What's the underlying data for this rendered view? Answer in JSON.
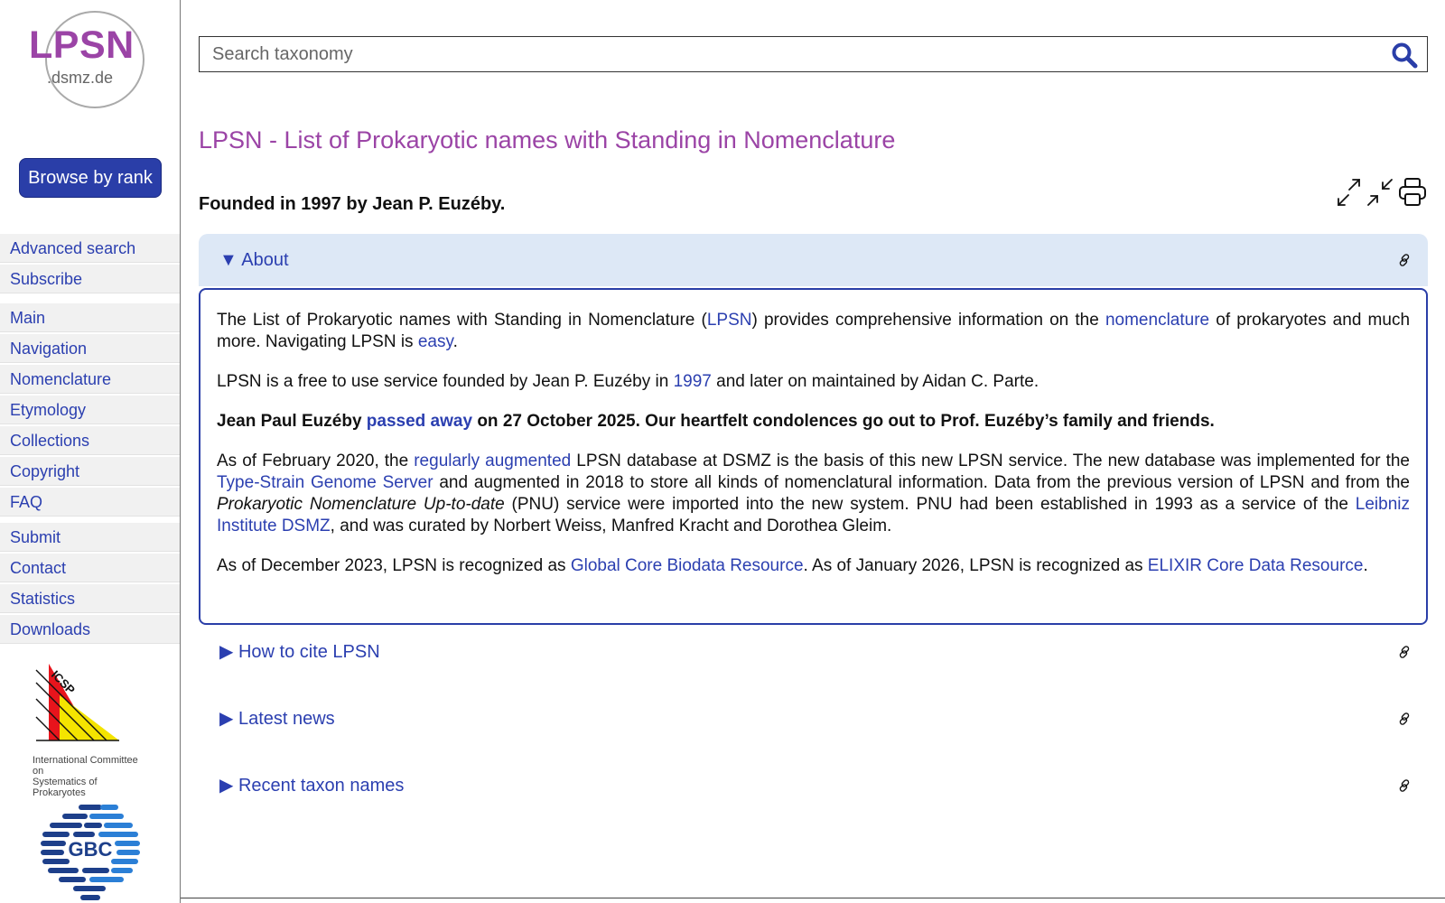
{
  "sidebar": {
    "logo_main": "LPSN",
    "logo_sub": ".dsmz.de",
    "browse_label": "Browse by rank",
    "groups": [
      [
        "Advanced search",
        "Subscribe"
      ],
      [
        "Main",
        "Navigation",
        "Nomenclature",
        "Etymology",
        "Collections",
        "Copyright",
        "FAQ"
      ],
      [
        "Submit",
        "Contact",
        "Statistics",
        "Downloads"
      ]
    ],
    "icsp_label": "ICSP",
    "icsp_caption_1": "International Committee on",
    "icsp_caption_2": "Systematics of Prokaryotes",
    "gbc_label": "GBC"
  },
  "search": {
    "placeholder": "Search taxonomy"
  },
  "header": {
    "title": "LPSN - List of Prokaryotic names with Standing in Nomenclature",
    "founded": "Founded in 1997 by Jean P. Euzéby."
  },
  "sections": {
    "about": {
      "toggle": "▼",
      "label": "About",
      "p1_a": "The List of Prokaryotic names with Standing in Nomenclature (",
      "p1_link1": "LPSN",
      "p1_b": ") provides comprehensive information on the ",
      "p1_link2": "nomenclature",
      "p1_c": " of prokaryotes and much more. Navigating LPSN is ",
      "p1_link3": "easy",
      "p1_d": ".",
      "p2_a": "LPSN is a free to use service founded by Jean P. Euzéby in ",
      "p2_link": "1997",
      "p2_b": " and later on maintained by Aidan C. Parte.",
      "p3_a": "Jean Paul Euzéby ",
      "p3_link": "passed away",
      "p3_b": " on 27 October 2025. Our heartfelt condolences go out to Prof. Euzéby’s family and friends.",
      "p4_a": "As of February 2020, the ",
      "p4_link1": "regularly augmented",
      "p4_b": " LPSN database at DSMZ is the basis of this new LPSN service. The new database was implemented for the ",
      "p4_link2": "Type-Strain Genome Server",
      "p4_c": " and augmented in 2018 to store all kinds of nomenclatural information. Data from the previous version of LPSN and from the ",
      "p4_italic": "Prokaryotic Nomenclature Up-to-date",
      "p4_d": " (PNU) service were imported into the new system. PNU had been established in 1993 as a service of the ",
      "p4_link3": "Leibniz Institute DSMZ",
      "p4_e": ", and was curated by Norbert Weiss, Manfred Kracht and Dorothea Gleim.",
      "p5_a": "As of December 2023, LPSN is recognized as ",
      "p5_link1": "Global Core Biodata Resource",
      "p5_b": ". As of January 2026, LPSN is recognized as ",
      "p5_link2": "ELIXIR Core Data Resource",
      "p5_c": "."
    },
    "cite": {
      "toggle": "▶",
      "label": "How to cite LPSN"
    },
    "news": {
      "toggle": "▶",
      "label": "Latest news"
    },
    "recent": {
      "toggle": "▶",
      "label": "Recent taxon names"
    }
  },
  "colors": {
    "accent": "#2a3ea8",
    "title": "#9b44a6",
    "about_bg": "#dde8f6",
    "nav_bg": "#f1f1f1"
  },
  "icons": [
    "search-icon",
    "expand-icon",
    "collapse-icon",
    "print-icon",
    "link-icon"
  ]
}
